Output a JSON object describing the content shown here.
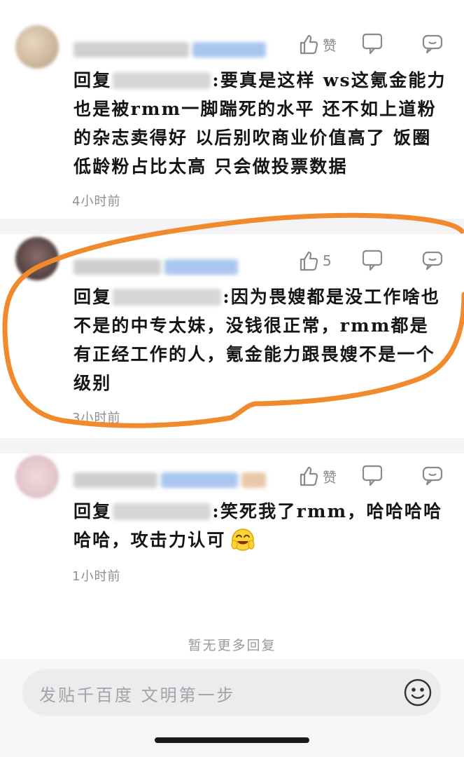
{
  "replies": [
    {
      "likes": "赞",
      "reply_prefix": "回复",
      "text": ":要真是这样 ws这氪金能力也是被rmm一脚踹死的水平 还不如上道粉的杂志卖得好 以后别吹商业价值高了 饭圈低龄粉占比太高 只会做投票数据",
      "time": "4小时前"
    },
    {
      "likes": "5",
      "reply_prefix": "回复",
      "text": ":因为畏嫂都是没工作啥也不是的中专太妹，没钱很正常，rmm都是有正经工作的人，氪金能力跟畏嫂不是一个级别",
      "time": "3小时前"
    },
    {
      "likes": "赞",
      "reply_prefix": "回复",
      "text": ":笑死我了rmm，哈哈哈哈哈哈，攻击力认可",
      "time": "1小时前"
    }
  ],
  "footer": {
    "no_more_text": "暂无更多回复",
    "input_placeholder": "发贴千百度 文明第一步"
  },
  "icons": {
    "like": "thumbs-up-icon",
    "dislike": "thumbs-down-icon",
    "reply": "comment-icon",
    "emoji": "smiley-icon",
    "inline_emoji": "laughing-face-emoji"
  },
  "colors": {
    "highlight_annotation": "#f08a2c",
    "name_blur": "#a9c6ee",
    "icon_gray": "#8a8a8a",
    "input_bg": "#ececef"
  }
}
